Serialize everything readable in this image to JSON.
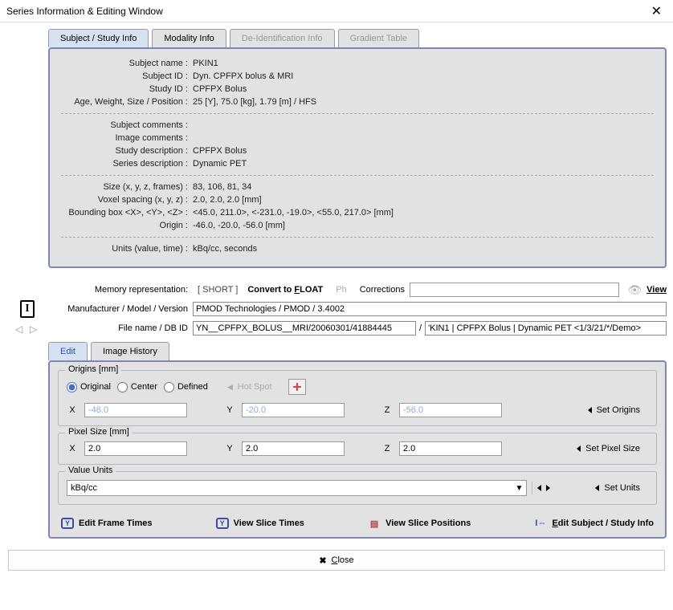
{
  "window": {
    "title": "Series Information & Editing Window"
  },
  "tabs": {
    "subject": "Subject / Study Info",
    "modality": "Modality Info",
    "deid": "De-Identification Info",
    "gradient": "Gradient Table"
  },
  "info": {
    "subject_name_k": "Subject name",
    "subject_name_v": "PKIN1",
    "subject_id_k": "Subject ID",
    "subject_id_v": "Dyn. CPFPX bolus & MRI",
    "study_id_k": "Study ID",
    "study_id_v": "CPFPX Bolus",
    "awsp_k": "Age, Weight, Size / Position",
    "awsp_v": "25 [Y], 75.0 [kg], 1.79 [m] / HFS",
    "subj_comments_k": "Subject comments",
    "subj_comments_v": "",
    "img_comments_k": "Image comments",
    "img_comments_v": "",
    "study_desc_k": "Study description",
    "study_desc_v": "CPFPX Bolus",
    "series_desc_k": "Series description",
    "series_desc_v": "Dynamic PET",
    "size_k": "Size (x, y, z,  frames)",
    "size_v": "83, 106, 81,  34",
    "voxel_k": "Voxel spacing (x, y, z)",
    "voxel_v": "2.0, 2.0, 2.0  [mm]",
    "bb_k": "Bounding box <X>, <Y>, <Z>",
    "bb_v": "<45.0, 211.0>,  <-231.0, -19.0>,  <55.0, 217.0>  [mm]",
    "origin_k": "Origin",
    "origin_v": "-46.0, -20.0, -56.0  [mm]",
    "units_k": "Units (value, time)",
    "units_v": "kBq/cc, seconds"
  },
  "mem": {
    "label": "Memory representation:",
    "short": "[ SHORT ]",
    "convert_pre": "Convert to ",
    "convert_u": "F",
    "convert_post": "LOAT",
    "ph": "Ph",
    "corrections": "Corrections",
    "corr_value": "",
    "view_u": "V",
    "view_post": "iew"
  },
  "mfr": {
    "label": "Manufacturer / Model / Version",
    "value": "PMOD Technologies / PMOD / 3.4002"
  },
  "file": {
    "label": "File name / DB ID",
    "v1": "YN__CPFPX_BOLUS__MRI/20060301/41884445",
    "sep": "/",
    "v2": "'KIN1 | CPFPX Bolus | Dynamic PET <1/3/21/*/Demo>"
  },
  "i_badge": "I",
  "edit_tabs": {
    "edit": "Edit",
    "history": "Image History"
  },
  "origins": {
    "legend": "Origins [mm]",
    "original": "Original",
    "center": "Center",
    "defined": "Defined",
    "hotspot": "Hot Spot",
    "x_l": "X",
    "y_l": "Y",
    "z_l": "Z",
    "x": "-46.0",
    "y": "-20.0",
    "z": "-56.0",
    "set": "Set Origins"
  },
  "pixel": {
    "legend": "Pixel Size [mm]",
    "x_l": "X",
    "y_l": "Y",
    "z_l": "Z",
    "x": "2.0",
    "y": "2.0",
    "z": "2.0",
    "set": "Set Pixel Size"
  },
  "units": {
    "legend": "Value Units",
    "value": "kBq/cc",
    "set": "Set Units"
  },
  "links": {
    "frame": "Edit Frame Times",
    "slice": "View Slice Times",
    "pos": "View Slice Positions",
    "subj_u": "E",
    "subj_post": "dit Subject / Study Info"
  },
  "bottom": {
    "close_u": "C",
    "close_post": "lose"
  }
}
